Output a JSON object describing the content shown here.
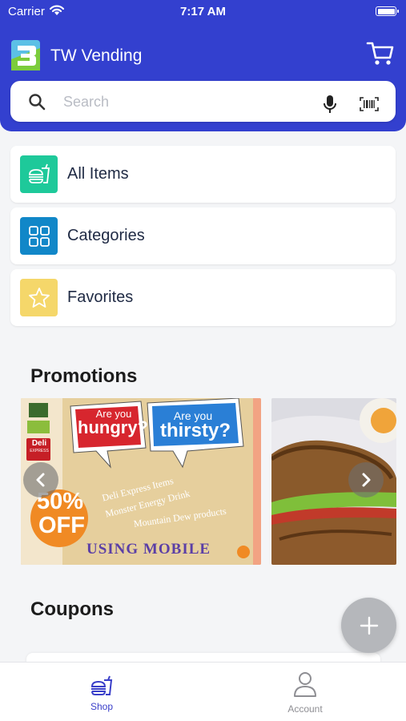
{
  "status_bar": {
    "carrier": "Carrier",
    "time": "7:17 AM"
  },
  "header": {
    "title": "TW Vending",
    "logo_icon": "tw-logo-icon",
    "cart_icon": "cart-icon"
  },
  "search": {
    "placeholder": "Search",
    "value": ""
  },
  "menu": [
    {
      "label": "All Items",
      "icon": "food-drink-icon",
      "color": "#1ec99a"
    },
    {
      "label": "Categories",
      "icon": "grid-icon",
      "color": "#1187c8"
    },
    {
      "label": "Favorites",
      "icon": "star-icon",
      "color": "#f5d76a"
    }
  ],
  "promotions": {
    "title": "Promotions",
    "banner1": {
      "bubble1": [
        "Are you",
        "hungry?"
      ],
      "bubble2": [
        "Are you",
        "thirsty?"
      ],
      "discount_line1": "50%",
      "discount_line2": "OFF",
      "items": [
        "Deli Express Items",
        "Monster Energy Drink",
        "Mountain Dew products"
      ],
      "footer": "USING MOBILE",
      "brand": "Deli",
      "brand_sub": "EXPRESS"
    }
  },
  "coupons": {
    "title": "Coupons"
  },
  "tabs": [
    {
      "label": "Shop",
      "active": true,
      "icon": "shop-icon"
    },
    {
      "label": "Account",
      "active": false,
      "icon": "account-icon"
    }
  ],
  "colors": {
    "primary": "#3340cf",
    "active_tab": "#3a3fc9",
    "inactive_tab": "#8e8e93"
  }
}
